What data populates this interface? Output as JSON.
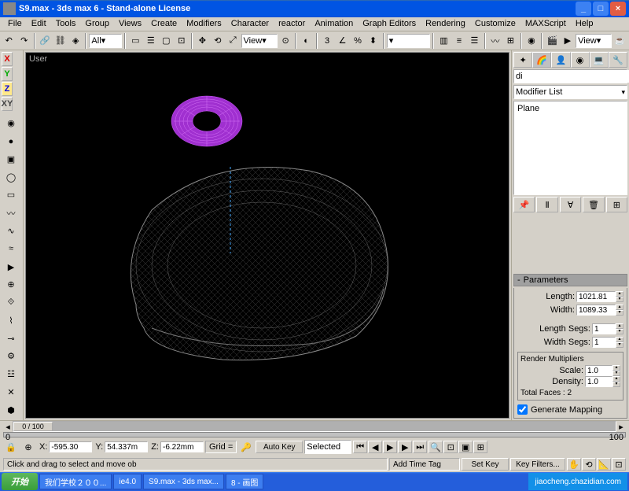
{
  "titlebar": {
    "text": "S9.max - 3ds max 6 - Stand-alone License"
  },
  "menu": [
    "File",
    "Edit",
    "Tools",
    "Group",
    "Views",
    "Create",
    "Modifiers",
    "Character",
    "reactor",
    "Animation",
    "Graph Editors",
    "Rendering",
    "Customize",
    "MAXScript",
    "Help"
  ],
  "toolbar": {
    "selection_filter": "All",
    "ref_coord": "View",
    "named_sel": "",
    "view_type": "View"
  },
  "viewport": {
    "label": "User"
  },
  "right": {
    "object_name": "di",
    "modifier_list_label": "Modifier List",
    "stack_items": [
      "Plane"
    ],
    "rollout_title": "Parameters",
    "length_label": "Length:",
    "length_value": "1021.81",
    "width_label": "Width:",
    "width_value": "1089.33",
    "length_segs_label": "Length Segs:",
    "length_segs_value": "1",
    "width_segs_label": "Width Segs:",
    "width_segs_value": "1",
    "render_mult_title": "Render Multipliers",
    "scale_label": "Scale:",
    "scale_value": "1.0",
    "density_label": "Density:",
    "density_value": "1.0",
    "total_faces": "Total Faces : 2",
    "gen_mapping": "Generate Mapping"
  },
  "timeline": {
    "pos": "0 / 100",
    "start": "0",
    "end": "100"
  },
  "coords": {
    "x_label": "X:",
    "x_value": "-595.30",
    "y_label": "Y:",
    "y_value": "54.337m",
    "z_label": "Z:",
    "z_value": "-6.22mm",
    "grid": "Grid ="
  },
  "status": {
    "prompt": "Click and drag to select and move ob",
    "time_tag": "Add Time Tag",
    "auto_key": "Auto Key",
    "set_key": "Set Key",
    "selected": "Selected",
    "key_filters": "Key Filters..."
  },
  "taskbar": {
    "start": "开始",
    "items": [
      "我们学校２００...",
      "ie4.0",
      "S9.max - 3ds max...",
      "8 - 画图"
    ],
    "watermark": "jiaocheng.chazidian.com"
  },
  "left_labels": {
    "x": "X",
    "y": "Y",
    "z": "Z",
    "xy": "XY"
  }
}
